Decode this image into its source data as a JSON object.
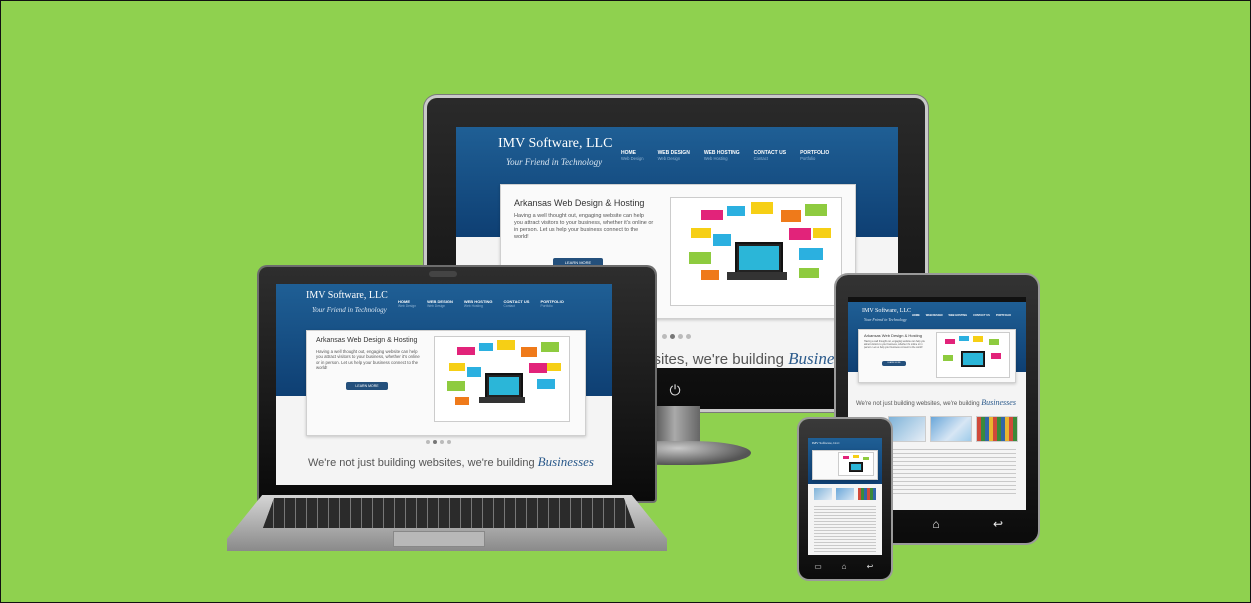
{
  "site": {
    "brand": "IMV Software, LLC",
    "tagline": "Your Friend in Technology",
    "nav": [
      {
        "label": "HOME",
        "sub": "Web Design"
      },
      {
        "label": "WEB DESIGN",
        "sub": "Web Design"
      },
      {
        "label": "WEB HOSTING",
        "sub": "Web Hosting"
      },
      {
        "label": "CONTACT US",
        "sub": "Contact"
      },
      {
        "label": "PORTFOLIO",
        "sub": "Portfolio"
      }
    ],
    "hero_title": "Arkansas Web Design & Hosting",
    "hero_body": "Having a well thought out, engaging website can help you attract visitors to your business, whether it's online or in person. Let us help your business connect to the world!",
    "hero_button": "LEARN MORE",
    "slogan_prefix": "We're not just building websites, we're building",
    "slogan_prefix_cropped": "websites, we're building",
    "slogan_script": "Businesses"
  },
  "colors": {
    "background": "#8fd14f",
    "header": "#1f5f95",
    "button": "#24507c"
  },
  "icons": [
    "power-icon",
    "home-icon",
    "back-icon"
  ]
}
